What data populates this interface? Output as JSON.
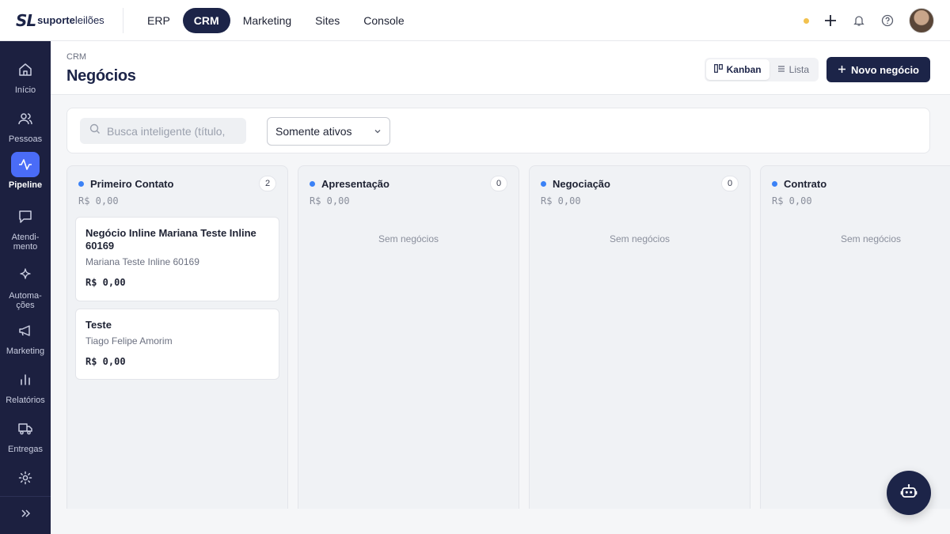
{
  "brand": {
    "mark": "SL",
    "name_bold": "suporte",
    "name_rest": "leilões"
  },
  "topnav": [
    {
      "label": "ERP"
    },
    {
      "label": "CRM",
      "active": true
    },
    {
      "label": "Marketing"
    },
    {
      "label": "Sites"
    },
    {
      "label": "Console"
    }
  ],
  "top_actions": {
    "status_color": "#f2c14e",
    "icons": [
      "plus-icon",
      "bell-icon",
      "help-icon"
    ]
  },
  "sidebar": {
    "items": [
      {
        "label": "Início",
        "icon": "home-icon"
      },
      {
        "label": "Pessoas",
        "icon": "users-icon"
      },
      {
        "label": "Pipeline",
        "icon": "activity-icon",
        "active": true
      },
      {
        "label": "Atendi-\nmento",
        "icon": "chat-icon"
      },
      {
        "label": "Automa-\nções",
        "icon": "sparkle-icon"
      },
      {
        "label": "Marketing",
        "icon": "megaphone-icon"
      },
      {
        "label": "Relatórios",
        "icon": "bar-chart-icon"
      },
      {
        "label": "Entregas",
        "icon": "truck-icon"
      },
      {
        "label": "",
        "icon": "gear-icon"
      }
    ],
    "expand_icon": "chevrons-right-icon"
  },
  "header": {
    "breadcrumb": "CRM",
    "title": "Negócios",
    "view_kanban": "Kanban",
    "view_list": "Lista",
    "new_button": "Novo negócio"
  },
  "filters": {
    "search_placeholder": "Busca inteligente (título,",
    "status_select": "Somente ativos"
  },
  "columns": [
    {
      "title": "Primeiro Contato",
      "count": "2",
      "total": "R$ 0,00",
      "color": "#3b82f6",
      "cards": [
        {
          "title": "Negócio Inline Mariana Teste Inline 60169",
          "contact": "Mariana Teste Inline 60169",
          "value": "R$ 0,00"
        },
        {
          "title": "Teste",
          "contact": "Tiago Felipe Amorim",
          "value": "R$ 0,00"
        }
      ]
    },
    {
      "title": "Apresentação",
      "count": "0",
      "total": "R$ 0,00",
      "color": "#3b82f6",
      "empty": "Sem negócios"
    },
    {
      "title": "Negociação",
      "count": "0",
      "total": "R$ 0,00",
      "color": "#3b82f6",
      "empty": "Sem negócios"
    },
    {
      "title": "Contrato",
      "count": "",
      "total": "R$ 0,00",
      "color": "#3b82f6",
      "empty": "Sem negócios"
    }
  ],
  "colors": {
    "primary": "#1c2448",
    "sidebar": "#1c2040",
    "accent": "#4a6cf7",
    "stage_dot": "#3b82f6"
  },
  "assistant_icon": "robot-icon"
}
